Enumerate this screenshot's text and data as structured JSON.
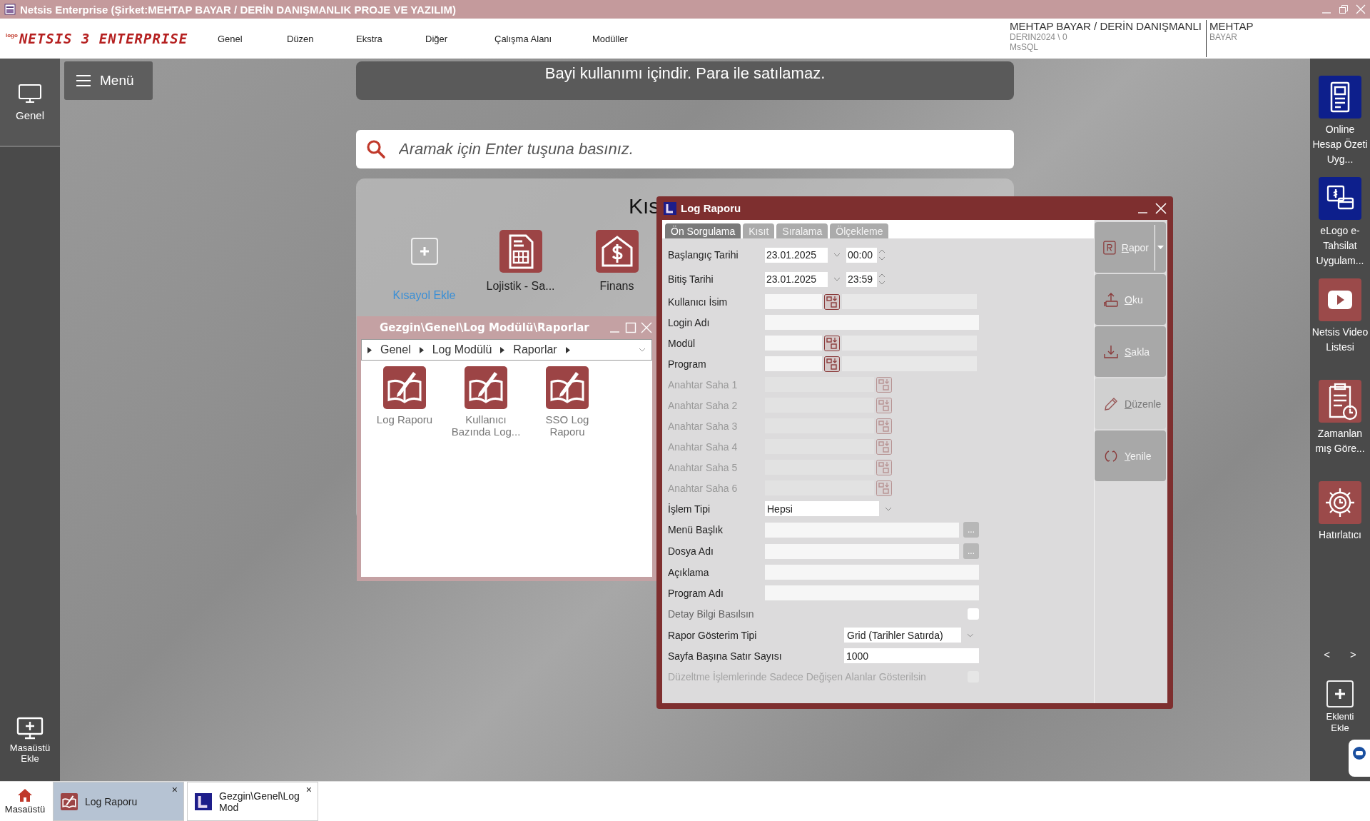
{
  "window": {
    "title": "Netsis Enterprise (Şirket:MEHTAP BAYAR / DERİN DANIŞMANLIK PROJE VE YAZILIM)"
  },
  "logo": {
    "prefix": "logo",
    "name": "NETSIS 3 ENTERPRISE"
  },
  "menu": [
    "Genel",
    "Düzen",
    "Ekstra",
    "Diğer",
    "Çalışma Alanı",
    "Modüller"
  ],
  "company": {
    "name": "MEHTAP BAYAR / DERİN DANIŞMANLI",
    "database": "DERIN2024 \\ 0",
    "server": "MsSQL",
    "user_line_1": "MEHTAP",
    "user_line_2": "BAYAR"
  },
  "left_sidebar": {
    "items": [
      {
        "label": "Genel",
        "selected": true
      }
    ],
    "add_label": "Masaüstü Ekle"
  },
  "menu_button": "Menü",
  "notice": "Bayi kullanımı içindir. Para ile satılamaz.",
  "search": {
    "placeholder": "Aramak için Enter tuşuna basınız."
  },
  "shortcuts": {
    "title": "Kıs",
    "items": [
      {
        "kind": "add",
        "label": "Kısayol Ekle"
      },
      {
        "kind": "invoice",
        "label": "Lojistik - Sa..."
      },
      {
        "kind": "finance",
        "label": "Finans"
      }
    ]
  },
  "explorer": {
    "title": "Gezgin\\Genel\\Log Modülü\\Raporlar",
    "breadcrumbs": [
      "Genel",
      "Log Modülü",
      "Raporlar"
    ],
    "items": [
      "Log Raporu",
      "Kullanıcı Bazında Log...",
      "SSO Log Raporu"
    ]
  },
  "dialog": {
    "title": "Log Raporu",
    "tabs": [
      {
        "label": "Ön Sorgulama",
        "selected": true
      },
      {
        "label": "Kısıt",
        "selected": false
      },
      {
        "label": "Sıralama",
        "selected": false
      },
      {
        "label": "Ölçekleme",
        "selected": false
      }
    ],
    "fields": [
      {
        "kind": "date",
        "label": "Başlangıç Tarihi",
        "date": "23.01.2025",
        "time": "00:00"
      },
      {
        "kind": "date",
        "label": "Bitiş Tarihi",
        "date": "23.01.2025",
        "time": "23:59"
      },
      {
        "kind": "lookup",
        "label": "Kullanıcı İsim"
      },
      {
        "kind": "text",
        "label": "Login Adı"
      },
      {
        "kind": "lookup",
        "label": "Modül"
      },
      {
        "kind": "lookup",
        "label": "Program"
      },
      {
        "kind": "key",
        "label": "Anahtar Saha 1",
        "disabled": true
      },
      {
        "kind": "key",
        "label": "Anahtar Saha 2",
        "disabled": true
      },
      {
        "kind": "key",
        "label": "Anahtar Saha 3",
        "disabled": true
      },
      {
        "kind": "key",
        "label": "Anahtar Saha 4",
        "disabled": true
      },
      {
        "kind": "key",
        "label": "Anahtar Saha 5",
        "disabled": true
      },
      {
        "kind": "key",
        "label": "Anahtar Saha 6",
        "disabled": true
      },
      {
        "kind": "select",
        "label": "İşlem Tipi",
        "value": "Hepsi"
      },
      {
        "kind": "ellipsis",
        "label": "Menü Başlık",
        "button": "..."
      },
      {
        "kind": "ellipsis",
        "label": "Dosya Adı",
        "button": "..."
      },
      {
        "kind": "text",
        "label": "Açıklama"
      },
      {
        "kind": "text",
        "label": "Program Adı"
      },
      {
        "kind": "check",
        "label": "Detay Bilgi Basılsın",
        "checked": false,
        "disabled": false
      },
      {
        "kind": "wide_select",
        "label": "Rapor Gösterim Tipi",
        "value": "Grid (Tarihler Satırda)"
      },
      {
        "kind": "wide_text",
        "label": "Sayfa Başına Satır Sayısı",
        "value": "1000"
      },
      {
        "kind": "check",
        "label": "Düzeltme İşlemlerinde Sadece Değişen Alanlar Gösterilsin",
        "checked": false,
        "disabled": true
      }
    ],
    "buttons": [
      {
        "kind": "report",
        "label": "Rapor",
        "disabled": false
      },
      {
        "kind": "read",
        "label": "Oku",
        "disabled": false
      },
      {
        "kind": "save",
        "label": "Sakla",
        "disabled": false
      },
      {
        "kind": "edit",
        "label": "Düzenle",
        "disabled": true
      },
      {
        "kind": "refresh",
        "label": "Yenile",
        "disabled": false
      }
    ]
  },
  "right_sidebar": {
    "items": [
      {
        "kind": "document",
        "label": "Online Hesap Özeti Uyg...",
        "color": "#0d1f8c"
      },
      {
        "kind": "payment",
        "label": "eLogo e-Tahsilat Uygulam...",
        "color": "#0d1f8c"
      },
      {
        "kind": "video",
        "label": "Netsis Video Listesi",
        "color": "#9b4a4a"
      },
      {
        "kind": "clipboard",
        "label": "Zamanlan mış Göre...",
        "color": "#9b4a4a"
      },
      {
        "kind": "gear",
        "label": "Hatırlatıcı",
        "color": "#9b4a4a"
      }
    ],
    "prev": "<",
    "next": ">",
    "add_label": "Eklenti Ekle"
  },
  "taskbar": [
    {
      "kind": "home",
      "label": "Masaüstü",
      "selected": false
    },
    {
      "kind": "report",
      "label": "Log Raporu",
      "selected": true,
      "close": "×"
    },
    {
      "kind": "explorer",
      "label": "Gezgin\\Genel\\Log Mod",
      "selected": false,
      "close": "×"
    }
  ]
}
